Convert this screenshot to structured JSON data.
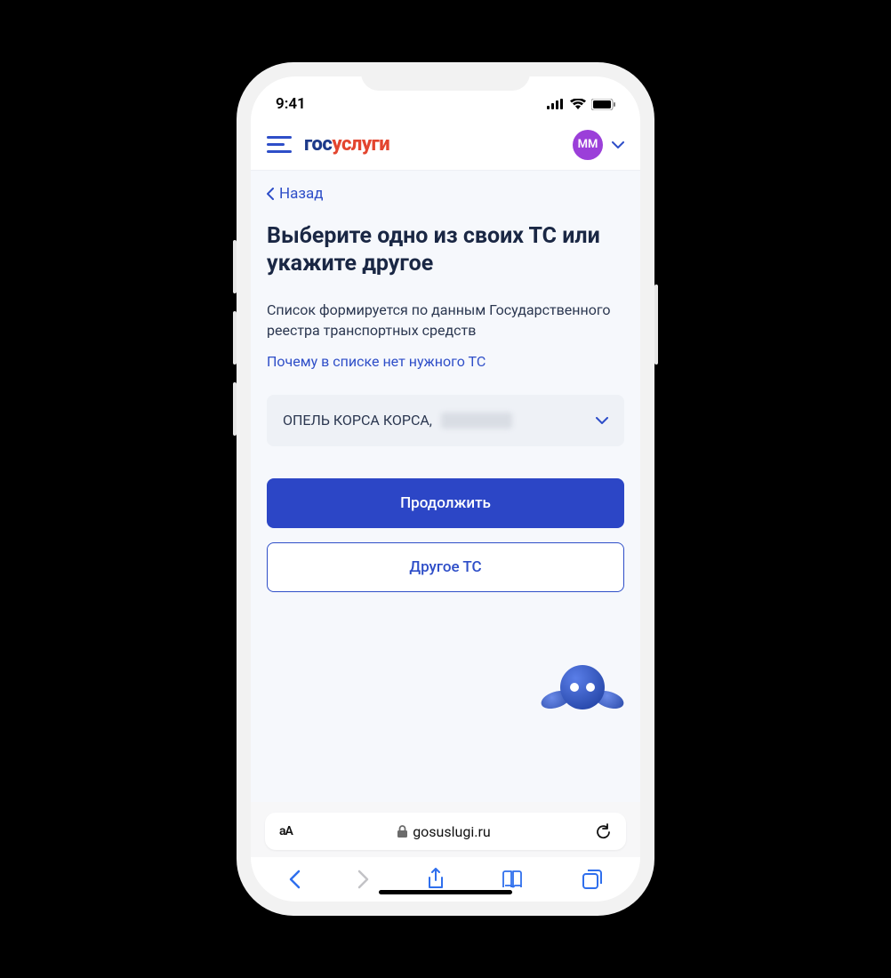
{
  "statusbar": {
    "time": "9:41"
  },
  "header": {
    "logo_part1": "гос",
    "logo_part2": "услуги",
    "avatar_initials": "ММ"
  },
  "page": {
    "back_label": "Назад",
    "title": "Выберите одно из своих ТС или укажите другое",
    "description": "Список формируется по данным Государственного реестра транспортных средств",
    "help_link": "Почему в списке нет нужного ТС",
    "select_value": "ОПЕЛЬ КОРСА КОРСА,",
    "continue_label": "Продолжить",
    "other_label": "Другое ТС"
  },
  "browser": {
    "aa": "аА",
    "domain": "gosuslugi.ru"
  },
  "colors": {
    "primary_blue": "#2c46c6",
    "link_blue": "#2e4ec8",
    "accent_red": "#e3452f",
    "avatar_purple": "#9b3fd9",
    "text_dark": "#1a2744"
  }
}
